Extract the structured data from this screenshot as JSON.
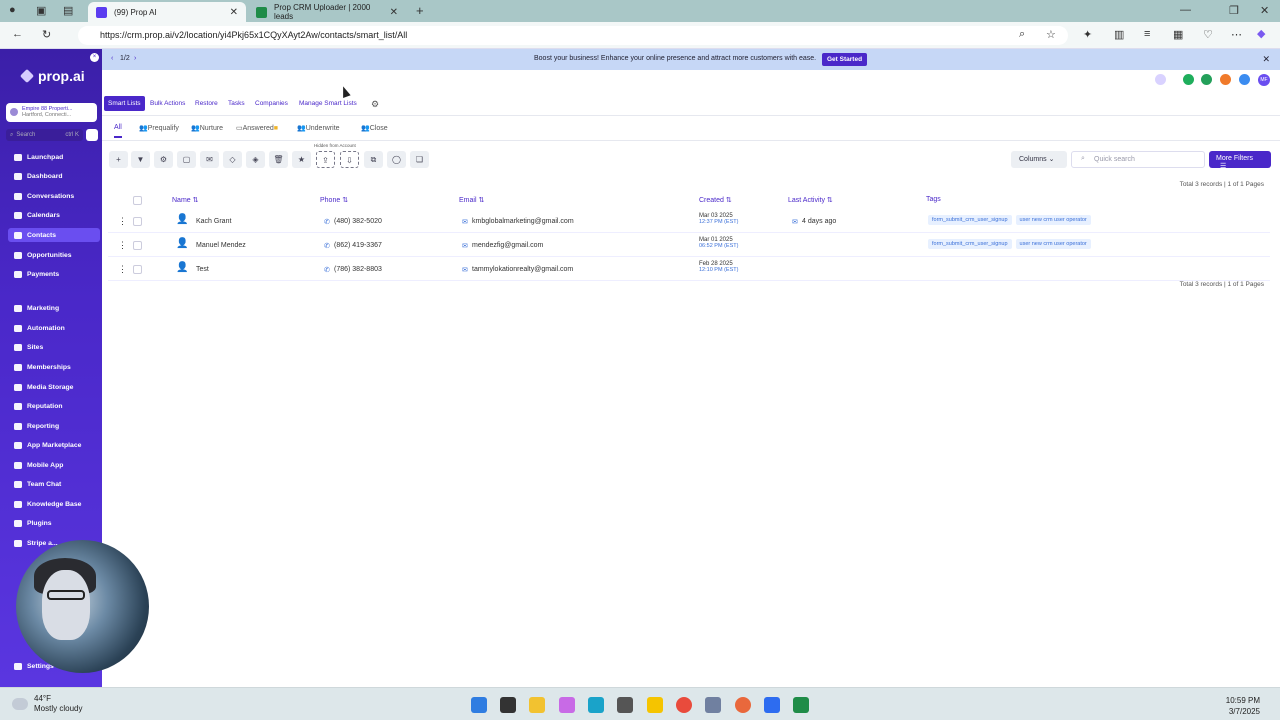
{
  "browser": {
    "tabs": [
      {
        "title": "(99) Prop AI",
        "favicon_color": "#5b3df0"
      },
      {
        "title": "Prop CRM Uploader | 2000 leads",
        "favicon_color": "#1f8c48"
      }
    ],
    "url": "https://crm.prop.ai/v2/location/yi4Pkj65x1CQyXAyt2Aw/contacts/smart_list/All"
  },
  "sidebar": {
    "logo": "prop.ai",
    "location_name": "Empire 88 Properti...",
    "location_city": "Hartford, Connecti...",
    "search_placeholder": "Search",
    "search_shortcut": "ctrl K",
    "items": [
      {
        "label": "Launchpad",
        "icon": "rocket-icon"
      },
      {
        "label": "Dashboard",
        "icon": "gauge-icon"
      },
      {
        "label": "Conversations",
        "icon": "chat-icon"
      },
      {
        "label": "Calendars",
        "icon": "calendar-icon"
      },
      {
        "label": "Contacts",
        "icon": "contacts-icon",
        "active": true
      },
      {
        "label": "Opportunities",
        "icon": "funnel-icon"
      },
      {
        "label": "Payments",
        "icon": "card-icon"
      },
      {
        "label": "Marketing",
        "icon": "megaphone-icon"
      },
      {
        "label": "Automation",
        "icon": "automation-icon"
      },
      {
        "label": "Sites",
        "icon": "globe-icon"
      },
      {
        "label": "Memberships",
        "icon": "membership-icon"
      },
      {
        "label": "Media Storage",
        "icon": "folder-icon"
      },
      {
        "label": "Reputation",
        "icon": "star-icon"
      },
      {
        "label": "Reporting",
        "icon": "chart-icon"
      },
      {
        "label": "App Marketplace",
        "icon": "store-icon"
      },
      {
        "label": "Mobile App",
        "icon": "phone-icon"
      },
      {
        "label": "Team Chat",
        "icon": "team-chat-icon"
      },
      {
        "label": "Knowledge Base",
        "icon": "book-icon"
      },
      {
        "label": "Plugins",
        "icon": "plugin-icon"
      },
      {
        "label": "Stripe a...",
        "icon": "stripe-icon"
      }
    ],
    "settings": "Settings"
  },
  "banner": {
    "text": "Boost your business! Enhance your online presence and attract more customers with ease.",
    "cta": "Get Started",
    "pager": "1/2"
  },
  "header_tabs": [
    "Smart Lists",
    "Bulk Actions",
    "Restore",
    "Tasks",
    "Companies",
    "Manage Smart Lists"
  ],
  "smart_lists": [
    "All",
    "Prequalify",
    "Nurture",
    "Answered",
    "Underwrite",
    "Close"
  ],
  "toolbar": {
    "hidden_note": "Hidden from Account",
    "columns": "Columns",
    "quick_search": "Quick search",
    "more_filters": "More Filters"
  },
  "table": {
    "headers": [
      "Name",
      "Phone",
      "Email",
      "Created",
      "Last Activity",
      "Tags"
    ],
    "pagination": "Total 3 records | 1 of 1 Pages",
    "rows": [
      {
        "name": "Kach Grant",
        "phone": "(480) 382-5020",
        "email": "kmbglobalmarketing@gmail.com",
        "created_date": "Mar 03 2025",
        "created_time": "12:37 PM (EST)",
        "last_activity": "4 days ago",
        "tags": [
          "form_submit_crm_user_signup",
          "user new crm user operator"
        ]
      },
      {
        "name": "Manuel Mendez",
        "phone": "(862) 419-3367",
        "email": "mendezfig@gmail.com",
        "created_date": "Mar 01 2025",
        "created_time": "06:52 PM (EST)",
        "last_activity": "",
        "tags": [
          "form_submit_crm_user_signup",
          "user new crm user operator"
        ]
      },
      {
        "name": "Test",
        "phone": "(786) 382-8803",
        "email": "tammylokationrealty@gmail.com",
        "created_date": "Feb 28 2025",
        "created_time": "12:10 PM (EST)",
        "last_activity": "",
        "tags": []
      }
    ]
  },
  "taskbar": {
    "temperature": "44°F",
    "weather": "Mostly cloudy",
    "time": "10:59 PM",
    "date": "3/7/2025"
  },
  "header_avatar": "MF"
}
